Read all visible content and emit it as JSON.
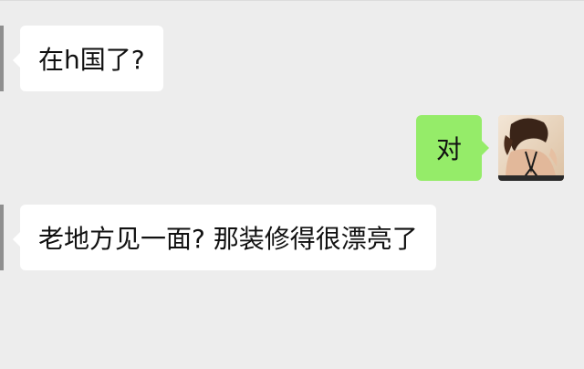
{
  "messages": [
    {
      "side": "left",
      "text": "在h国了?"
    },
    {
      "side": "right",
      "text": "对"
    },
    {
      "side": "left",
      "text": "老地方见一面? 那装修得很漂亮了"
    }
  ],
  "colors": {
    "background": "#ededed",
    "incoming_bubble": "#ffffff",
    "outgoing_bubble": "#95ec69"
  }
}
